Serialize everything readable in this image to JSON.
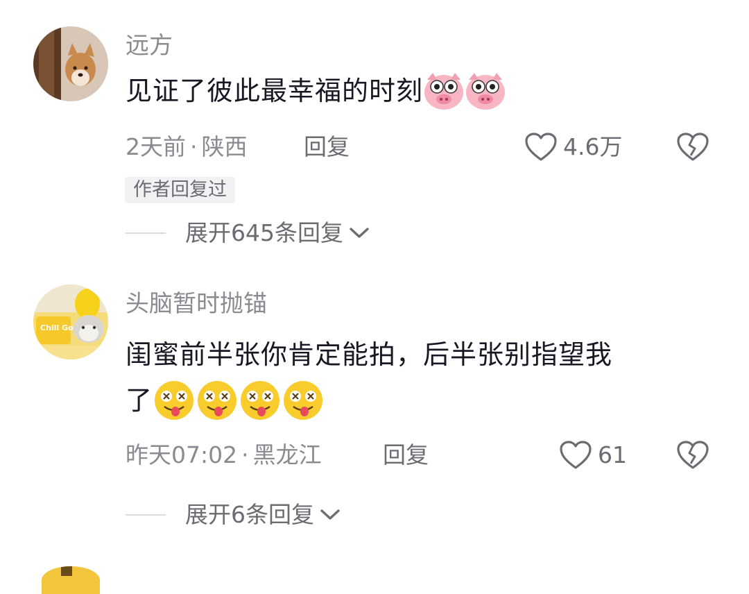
{
  "comments": [
    {
      "username": "远方",
      "text": "见证了彼此最幸福的时刻",
      "emoji_names": [
        "pig-face-emoji",
        "pig-face-emoji"
      ],
      "time": "2天前",
      "location": "陕西",
      "reply_label": "回复",
      "likes": "4.6万",
      "author_replied_tag": "作者回复过",
      "expand_label": "展开645条回复"
    },
    {
      "username": "头脑暂时抛锚",
      "text_line1": "闺蜜前半张你肯定能拍，后半张别指望我",
      "text_line2": "了",
      "emoji_names": [
        "dizzy-tongue-emoji",
        "dizzy-tongue-emoji",
        "dizzy-tongue-emoji",
        "dizzy-tongue-emoji"
      ],
      "time": "昨天07:02",
      "location": "黑龙江",
      "reply_label": "回复",
      "likes": "61",
      "expand_label": "展开6条回复"
    }
  ],
  "meta_separator": "·",
  "avatar1_badge": "Chill Goods",
  "colors": {
    "secondary_text": "#8a8b91",
    "primary_text": "#161823",
    "tag_bg": "#f2f2f4"
  }
}
